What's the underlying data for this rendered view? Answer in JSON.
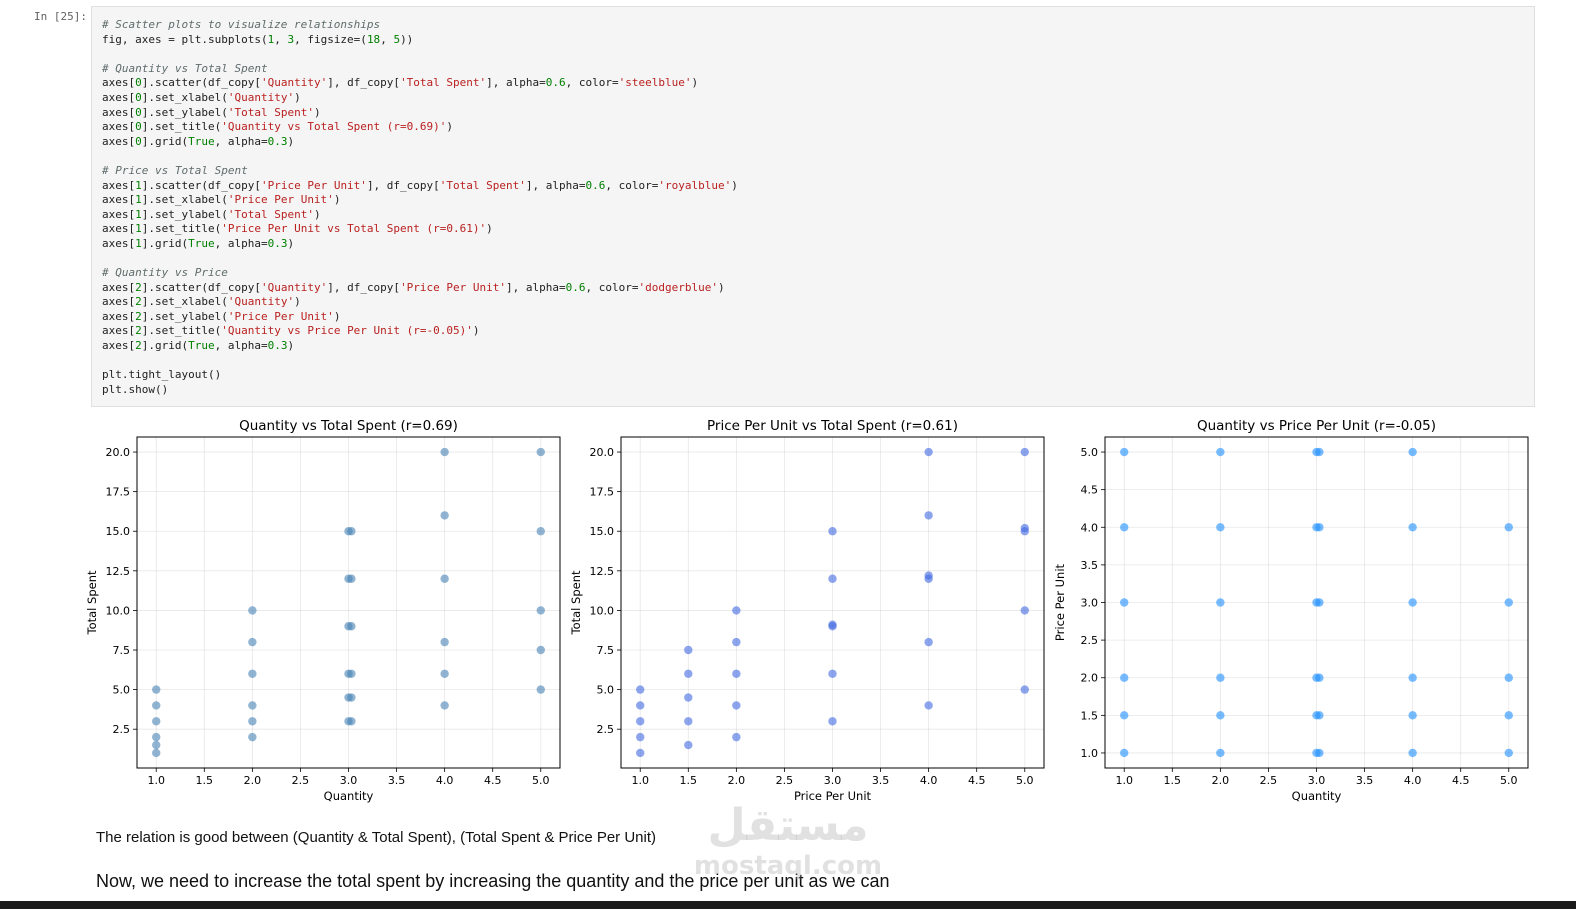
{
  "cell": {
    "prompt": "In [25]:",
    "code_lines": [
      [
        {
          "t": "# Scatter plots to visualize relationships",
          "c": "com"
        }
      ],
      [
        {
          "t": "fig, axes = plt.subplots(",
          "c": "fn"
        },
        {
          "t": "1",
          "c": "num"
        },
        {
          "t": ", ",
          "c": "fn"
        },
        {
          "t": "3",
          "c": "num"
        },
        {
          "t": ", figsize=(",
          "c": "fn"
        },
        {
          "t": "18",
          "c": "num"
        },
        {
          "t": ", ",
          "c": "fn"
        },
        {
          "t": "5",
          "c": "num"
        },
        {
          "t": "))",
          "c": "fn"
        }
      ],
      [],
      [
        {
          "t": "# Quantity vs Total Spent",
          "c": "com"
        }
      ],
      [
        {
          "t": "axes[",
          "c": "fn"
        },
        {
          "t": "0",
          "c": "num"
        },
        {
          "t": "].scatter(df_copy[",
          "c": "fn"
        },
        {
          "t": "'Quantity'",
          "c": "str"
        },
        {
          "t": "], df_copy[",
          "c": "fn"
        },
        {
          "t": "'Total Spent'",
          "c": "str"
        },
        {
          "t": "], alpha=",
          "c": "fn"
        },
        {
          "t": "0.6",
          "c": "num"
        },
        {
          "t": ", color=",
          "c": "fn"
        },
        {
          "t": "'steelblue'",
          "c": "str"
        },
        {
          "t": ")",
          "c": "fn"
        }
      ],
      [
        {
          "t": "axes[",
          "c": "fn"
        },
        {
          "t": "0",
          "c": "num"
        },
        {
          "t": "].set_xlabel(",
          "c": "fn"
        },
        {
          "t": "'Quantity'",
          "c": "str"
        },
        {
          "t": ")",
          "c": "fn"
        }
      ],
      [
        {
          "t": "axes[",
          "c": "fn"
        },
        {
          "t": "0",
          "c": "num"
        },
        {
          "t": "].set_ylabel(",
          "c": "fn"
        },
        {
          "t": "'Total Spent'",
          "c": "str"
        },
        {
          "t": ")",
          "c": "fn"
        }
      ],
      [
        {
          "t": "axes[",
          "c": "fn"
        },
        {
          "t": "0",
          "c": "num"
        },
        {
          "t": "].set_title(",
          "c": "fn"
        },
        {
          "t": "'Quantity vs Total Spent (r=0.69)'",
          "c": "str"
        },
        {
          "t": ")",
          "c": "fn"
        }
      ],
      [
        {
          "t": "axes[",
          "c": "fn"
        },
        {
          "t": "0",
          "c": "num"
        },
        {
          "t": "].grid(",
          "c": "fn"
        },
        {
          "t": "True",
          "c": "kw"
        },
        {
          "t": ", alpha=",
          "c": "fn"
        },
        {
          "t": "0.3",
          "c": "num"
        },
        {
          "t": ")",
          "c": "fn"
        }
      ],
      [],
      [
        {
          "t": "# Price vs Total Spent",
          "c": "com"
        }
      ],
      [
        {
          "t": "axes[",
          "c": "fn"
        },
        {
          "t": "1",
          "c": "num"
        },
        {
          "t": "].scatter(df_copy[",
          "c": "fn"
        },
        {
          "t": "'Price Per Unit'",
          "c": "str"
        },
        {
          "t": "], df_copy[",
          "c": "fn"
        },
        {
          "t": "'Total Spent'",
          "c": "str"
        },
        {
          "t": "], alpha=",
          "c": "fn"
        },
        {
          "t": "0.6",
          "c": "num"
        },
        {
          "t": ", color=",
          "c": "fn"
        },
        {
          "t": "'royalblue'",
          "c": "str"
        },
        {
          "t": ")",
          "c": "fn"
        }
      ],
      [
        {
          "t": "axes[",
          "c": "fn"
        },
        {
          "t": "1",
          "c": "num"
        },
        {
          "t": "].set_xlabel(",
          "c": "fn"
        },
        {
          "t": "'Price Per Unit'",
          "c": "str"
        },
        {
          "t": ")",
          "c": "fn"
        }
      ],
      [
        {
          "t": "axes[",
          "c": "fn"
        },
        {
          "t": "1",
          "c": "num"
        },
        {
          "t": "].set_ylabel(",
          "c": "fn"
        },
        {
          "t": "'Total Spent'",
          "c": "str"
        },
        {
          "t": ")",
          "c": "fn"
        }
      ],
      [
        {
          "t": "axes[",
          "c": "fn"
        },
        {
          "t": "1",
          "c": "num"
        },
        {
          "t": "].set_title(",
          "c": "fn"
        },
        {
          "t": "'Price Per Unit vs Total Spent (r=0.61)'",
          "c": "str"
        },
        {
          "t": ")",
          "c": "fn"
        }
      ],
      [
        {
          "t": "axes[",
          "c": "fn"
        },
        {
          "t": "1",
          "c": "num"
        },
        {
          "t": "].grid(",
          "c": "fn"
        },
        {
          "t": "True",
          "c": "kw"
        },
        {
          "t": ", alpha=",
          "c": "fn"
        },
        {
          "t": "0.3",
          "c": "num"
        },
        {
          "t": ")",
          "c": "fn"
        }
      ],
      [],
      [
        {
          "t": "# Quantity vs Price",
          "c": "com"
        }
      ],
      [
        {
          "t": "axes[",
          "c": "fn"
        },
        {
          "t": "2",
          "c": "num"
        },
        {
          "t": "].scatter(df_copy[",
          "c": "fn"
        },
        {
          "t": "'Quantity'",
          "c": "str"
        },
        {
          "t": "], df_copy[",
          "c": "fn"
        },
        {
          "t": "'Price Per Unit'",
          "c": "str"
        },
        {
          "t": "], alpha=",
          "c": "fn"
        },
        {
          "t": "0.6",
          "c": "num"
        },
        {
          "t": ", color=",
          "c": "fn"
        },
        {
          "t": "'dodgerblue'",
          "c": "str"
        },
        {
          "t": ")",
          "c": "fn"
        }
      ],
      [
        {
          "t": "axes[",
          "c": "fn"
        },
        {
          "t": "2",
          "c": "num"
        },
        {
          "t": "].set_xlabel(",
          "c": "fn"
        },
        {
          "t": "'Quantity'",
          "c": "str"
        },
        {
          "t": ")",
          "c": "fn"
        }
      ],
      [
        {
          "t": "axes[",
          "c": "fn"
        },
        {
          "t": "2",
          "c": "num"
        },
        {
          "t": "].set_ylabel(",
          "c": "fn"
        },
        {
          "t": "'Price Per Unit'",
          "c": "str"
        },
        {
          "t": ")",
          "c": "fn"
        }
      ],
      [
        {
          "t": "axes[",
          "c": "fn"
        },
        {
          "t": "2",
          "c": "num"
        },
        {
          "t": "].set_title(",
          "c": "fn"
        },
        {
          "t": "'Quantity vs Price Per Unit (r=-0.05)'",
          "c": "str"
        },
        {
          "t": ")",
          "c": "fn"
        }
      ],
      [
        {
          "t": "axes[",
          "c": "fn"
        },
        {
          "t": "2",
          "c": "num"
        },
        {
          "t": "].grid(",
          "c": "fn"
        },
        {
          "t": "True",
          "c": "kw"
        },
        {
          "t": ", alpha=",
          "c": "fn"
        },
        {
          "t": "0.3",
          "c": "num"
        },
        {
          "t": ")",
          "c": "fn"
        }
      ],
      [],
      [
        {
          "t": "plt.tight_layout()",
          "c": "fn"
        }
      ],
      [
        {
          "t": "plt.show()",
          "c": "fn"
        }
      ]
    ],
    "colors": {
      "com": "#5f6b6b",
      "str": "#ba2121",
      "num": "#008000",
      "kw": "#008000",
      "fn": "#212121"
    }
  },
  "chart_data": [
    {
      "type": "scatter",
      "title": "Quantity vs Total Spent (r=0.69)",
      "xlabel": "Quantity",
      "ylabel": "Total Spent",
      "color": "#4682b4",
      "alpha": 0.6,
      "grid": true,
      "xlim": [
        0.8,
        5.2
      ],
      "ylim": [
        0.05,
        20.95
      ],
      "xticks": [
        1.0,
        1.5,
        2.0,
        2.5,
        3.0,
        3.5,
        4.0,
        4.5,
        5.0
      ],
      "xtick_labels": [
        "1.0",
        "1.5",
        "2.0",
        "2.5",
        "3.0",
        "3.5",
        "4.0",
        "4.5",
        "5.0"
      ],
      "yticks": [
        2.5,
        5.0,
        7.5,
        10.0,
        12.5,
        15.0,
        17.5,
        20.0
      ],
      "ytick_labels": [
        "2.5",
        "5.0",
        "7.5",
        "10.0",
        "12.5",
        "15.0",
        "17.5",
        "20.0"
      ],
      "points": [
        [
          1,
          1
        ],
        [
          1,
          1.5
        ],
        [
          1,
          2
        ],
        [
          1,
          3
        ],
        [
          1,
          4
        ],
        [
          1,
          5
        ],
        [
          2,
          2
        ],
        [
          2,
          3
        ],
        [
          2,
          4
        ],
        [
          2,
          6
        ],
        [
          2,
          8
        ],
        [
          2,
          10
        ],
        [
          3,
          3
        ],
        [
          3,
          4.5
        ],
        [
          3,
          6
        ],
        [
          3,
          9
        ],
        [
          3,
          12
        ],
        [
          3,
          15
        ],
        [
          3.03,
          3
        ],
        [
          3.03,
          4.5
        ],
        [
          3.03,
          6
        ],
        [
          3.03,
          9
        ],
        [
          3.03,
          12
        ],
        [
          3.03,
          15
        ],
        [
          4,
          4
        ],
        [
          4,
          6
        ],
        [
          4,
          8
        ],
        [
          4,
          12
        ],
        [
          4,
          16
        ],
        [
          4,
          20
        ],
        [
          5,
          5
        ],
        [
          5,
          7.5
        ],
        [
          5,
          10
        ],
        [
          5,
          15
        ],
        [
          5,
          20
        ]
      ]
    },
    {
      "type": "scatter",
      "title": "Price Per Unit vs Total Spent (r=0.61)",
      "xlabel": "Price Per Unit",
      "ylabel": "Total Spent",
      "color": "#4169e1",
      "alpha": 0.6,
      "grid": true,
      "xlim": [
        0.8,
        5.2
      ],
      "ylim": [
        0.05,
        20.95
      ],
      "xticks": [
        1.0,
        1.5,
        2.0,
        2.5,
        3.0,
        3.5,
        4.0,
        4.5,
        5.0
      ],
      "xtick_labels": [
        "1.0",
        "1.5",
        "2.0",
        "2.5",
        "3.0",
        "3.5",
        "4.0",
        "4.5",
        "5.0"
      ],
      "yticks": [
        2.5,
        5.0,
        7.5,
        10.0,
        12.5,
        15.0,
        17.5,
        20.0
      ],
      "ytick_labels": [
        "2.5",
        "5.0",
        "7.5",
        "10.0",
        "12.5",
        "15.0",
        "17.5",
        "20.0"
      ],
      "points": [
        [
          1,
          1
        ],
        [
          1,
          2
        ],
        [
          1,
          3
        ],
        [
          1,
          4
        ],
        [
          1,
          5
        ],
        [
          1.5,
          1.5
        ],
        [
          1.5,
          3
        ],
        [
          1.5,
          4.5
        ],
        [
          1.5,
          6
        ],
        [
          1.5,
          7.5
        ],
        [
          2,
          2
        ],
        [
          2,
          4
        ],
        [
          2,
          6
        ],
        [
          2,
          8
        ],
        [
          2,
          10
        ],
        [
          3,
          3
        ],
        [
          3,
          6
        ],
        [
          3,
          9
        ],
        [
          3,
          9.1
        ],
        [
          3,
          12
        ],
        [
          3,
          15
        ],
        [
          4,
          4
        ],
        [
          4,
          8
        ],
        [
          4,
          12
        ],
        [
          4,
          12.2
        ],
        [
          4,
          16
        ],
        [
          4,
          20
        ],
        [
          5,
          5
        ],
        [
          5,
          10
        ],
        [
          5,
          15
        ],
        [
          5,
          15.2
        ],
        [
          5,
          20
        ]
      ]
    },
    {
      "type": "scatter",
      "title": "Quantity vs Price Per Unit (r=-0.05)",
      "xlabel": "Quantity",
      "ylabel": "Price Per Unit",
      "color": "#1e90ff",
      "alpha": 0.6,
      "grid": true,
      "xlim": [
        0.8,
        5.2
      ],
      "ylim": [
        0.8,
        5.2
      ],
      "xticks": [
        1.0,
        1.5,
        2.0,
        2.5,
        3.0,
        3.5,
        4.0,
        4.5,
        5.0
      ],
      "xtick_labels": [
        "1.0",
        "1.5",
        "2.0",
        "2.5",
        "3.0",
        "3.5",
        "4.0",
        "4.5",
        "5.0"
      ],
      "yticks": [
        1.0,
        1.5,
        2.0,
        2.5,
        3.0,
        3.5,
        4.0,
        4.5,
        5.0
      ],
      "ytick_labels": [
        "1.0",
        "1.5",
        "2.0",
        "2.5",
        "3.0",
        "3.5",
        "4.0",
        "4.5",
        "5.0"
      ],
      "points": [
        [
          1,
          1
        ],
        [
          1,
          1.5
        ],
        [
          1,
          2
        ],
        [
          1,
          3
        ],
        [
          1,
          4
        ],
        [
          1,
          5
        ],
        [
          2,
          1
        ],
        [
          2,
          1.5
        ],
        [
          2,
          2
        ],
        [
          2,
          3
        ],
        [
          2,
          4
        ],
        [
          2,
          5
        ],
        [
          3,
          1
        ],
        [
          3,
          1.5
        ],
        [
          3,
          2
        ],
        [
          3,
          3
        ],
        [
          3,
          4
        ],
        [
          3,
          5
        ],
        [
          3.03,
          1
        ],
        [
          3.03,
          1.5
        ],
        [
          3.03,
          2
        ],
        [
          3.03,
          3
        ],
        [
          3.03,
          4
        ],
        [
          3.03,
          5
        ],
        [
          4,
          1
        ],
        [
          4,
          1.5
        ],
        [
          4,
          2
        ],
        [
          4,
          3
        ],
        [
          4,
          4
        ],
        [
          4,
          5
        ],
        [
          5,
          1
        ],
        [
          5,
          1.5
        ],
        [
          5,
          2
        ],
        [
          5,
          3
        ],
        [
          5,
          4
        ]
      ]
    }
  ],
  "markdown": {
    "line1": "The relation is good between (Quantity & Total Spent), (Total Spent & Price Per Unit)",
    "line2": "Now, we need to increase the total spent by increasing the quantity and the price per unit as we can"
  },
  "watermark": {
    "line1": "مستقل",
    "line2": "mostaql.com"
  }
}
